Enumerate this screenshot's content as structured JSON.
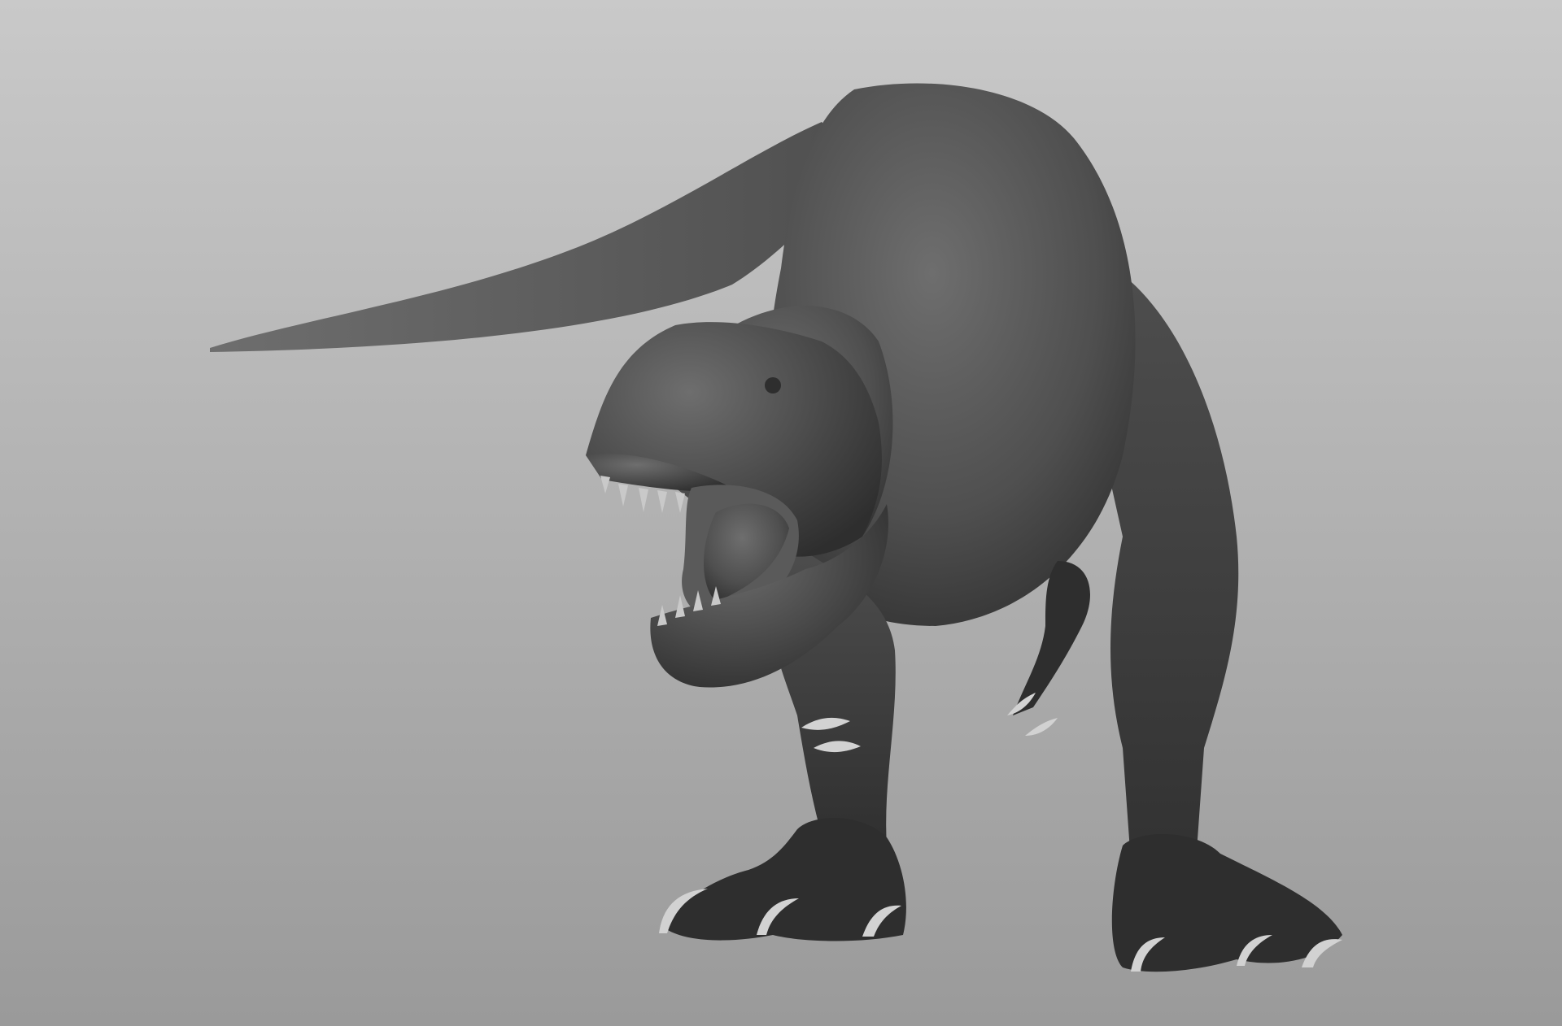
{
  "scene": {
    "subject": "tyrannosaurus-rex",
    "background": {
      "top_color": "#c9c9c9",
      "bottom_color": "#9a9a9a"
    },
    "material": {
      "body_light": "#6e6e6e",
      "body_mid": "#4f4f4f",
      "body_dark": "#2e2e2e",
      "mouth_color": "#5a5a5a",
      "tooth_color": "#c9c9c9",
      "claw_color": "#d2d2d2"
    }
  }
}
